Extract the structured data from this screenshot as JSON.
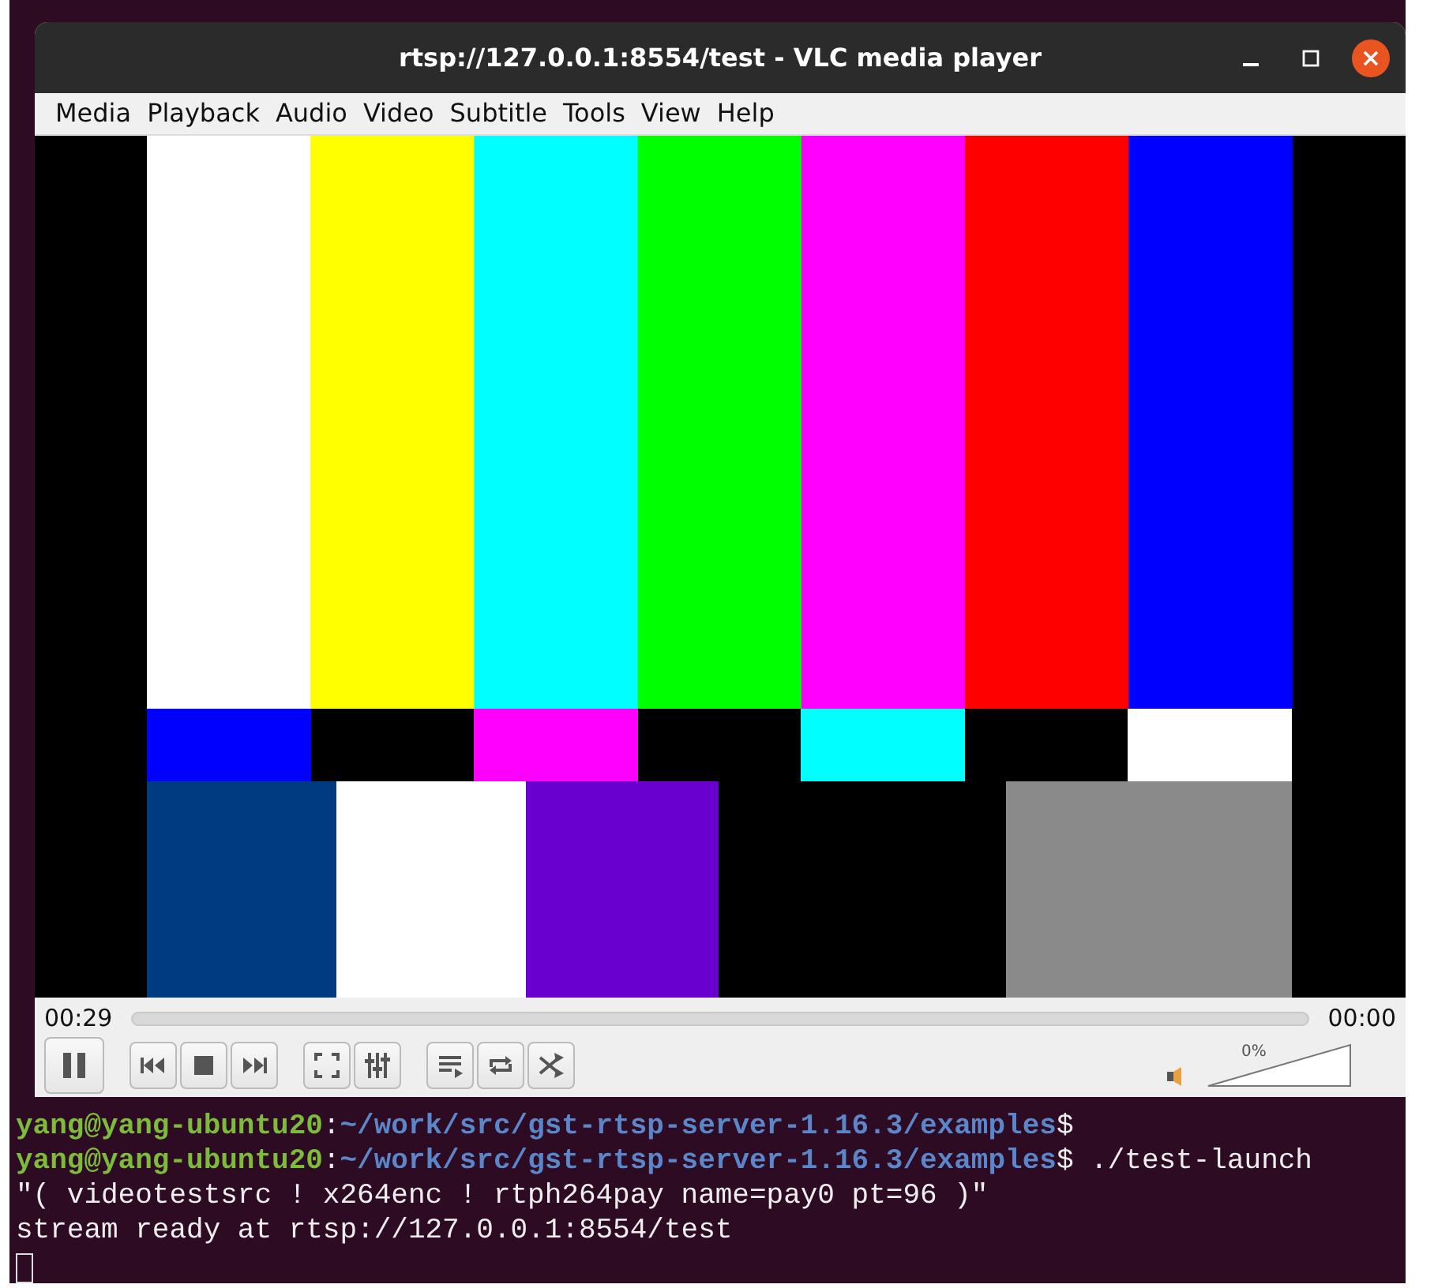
{
  "terminal": {
    "lines": [
      {
        "kind": "prompt",
        "user": "yang@yang-ubuntu20",
        "separator": ":",
        "path": "~/work/src/gst-rtsp-server-1.16.3/examples",
        "symbol": "$"
      },
      {
        "kind": "prompt",
        "user": "yang@yang-ubuntu20",
        "separator": ":",
        "path": "~/work/src/gst-rtsp-server-1.16.3/examples",
        "symbol": "$",
        "command": " ./test-launch"
      },
      {
        "kind": "output",
        "text": "\"( videotestsrc ! x264enc ! rtph264pay name=pay0 pt=96 )\""
      },
      {
        "kind": "output",
        "text": "stream ready at rtsp://127.0.0.1:8554/test"
      }
    ]
  },
  "window": {
    "title": "rtsp://127.0.0.1:8554/test - VLC media player"
  },
  "menu": [
    "Media",
    "Playback",
    "Audio",
    "Video",
    "Subtitle",
    "Tools",
    "View",
    "Help"
  ],
  "seek": {
    "elapsed": "00:29",
    "total": "00:00",
    "level": 0
  },
  "control_groups": [
    {
      "buttons": [
        {
          "kind": "pause"
        }
      ]
    },
    {
      "buttons": [
        {
          "kind": "previous"
        },
        {
          "kind": "stop"
        },
        {
          "kind": "next"
        }
      ]
    },
    {
      "buttons": [
        {
          "kind": "fullscreen"
        },
        {
          "kind": "settings"
        }
      ]
    },
    {
      "buttons": [
        {
          "kind": "playlist"
        },
        {
          "kind": "loop"
        },
        {
          "kind": "shuffle"
        }
      ]
    }
  ],
  "volume": {
    "reading": "0%",
    "level": 0
  }
}
